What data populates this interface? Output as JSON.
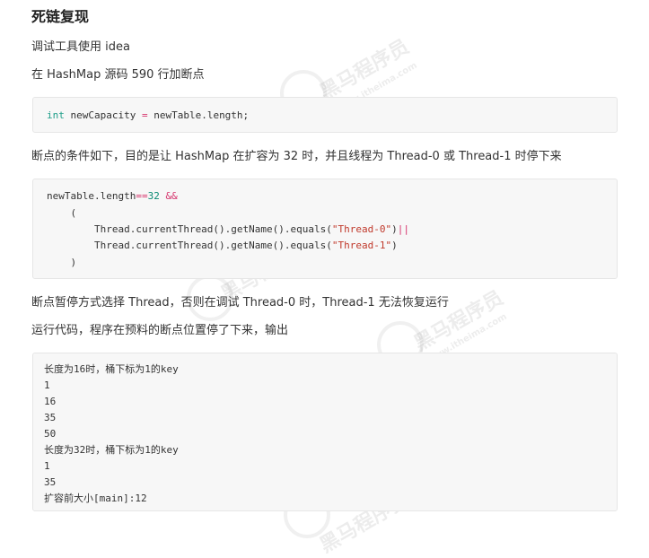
{
  "heading": "死链复现",
  "paragraphs": {
    "p1": "调试工具使用 idea",
    "p2": "在 HashMap 源码 590 行加断点",
    "p3": "断点的条件如下，目的是让 HashMap 在扩容为 32 时，并且线程为 Thread-0 或 Thread-1 时停下来",
    "p4": "断点暂停方式选择 Thread，否则在调试 Thread-0 时，Thread-1 无法恢复运行",
    "p5": "运行代码，程序在预料的断点位置停了下来，输出"
  },
  "code1": {
    "kw": "int",
    "rest1": " newCapacity ",
    "eq": "=",
    "rest2": " newTable.length;"
  },
  "code2": {
    "l1a": "newTable.length",
    "l1op": "==",
    "l1num": "32",
    "l1sp": " ",
    "l1and": "&&",
    "l2": "    (",
    "l3a": "        Thread.currentThread().getName().equals(",
    "l3str": "\"Thread-0\"",
    "l3b": ")",
    "l3or": "||",
    "l4a": "        Thread.currentThread().getName().equals(",
    "l4str": "\"Thread-1\"",
    "l4b": ")",
    "l5": "    )"
  },
  "output": {
    "lines": [
      "长度为16时，桶下标为1的key",
      "1",
      "16",
      "35",
      "50",
      "长度为32时，桶下标为1的key",
      "1",
      "35",
      "扩容前大小[main]:12"
    ]
  },
  "watermark": {
    "text": "黑马程序员",
    "sub": "www.itheima.com"
  }
}
